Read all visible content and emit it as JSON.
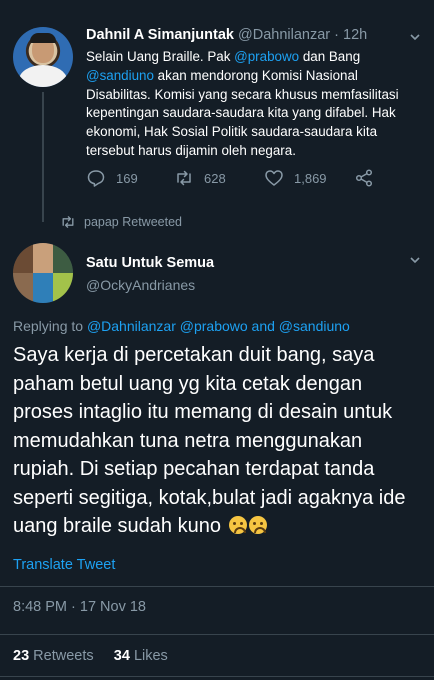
{
  "parent_tweet": {
    "name": "Dahnil A Simanjuntak",
    "handle": "@Dahnilanzar",
    "age": "12h",
    "text_parts": [
      "Selain Uang Braille. Pak ",
      "@prabowo",
      " dan Bang ",
      "@sandiuno",
      " akan mendorong Komisi Nasional Disabilitas. Komisi yang secara khusus memfasilitasi kepentingan saudara-saudara kita yang difabel. Hak ekonomi, Hak Sosial Politik  saudara-saudara kita tersebut harus dijamin oleh negara."
    ],
    "replies": "169",
    "retweets": "628",
    "likes": "1,869"
  },
  "retweet_note": "papap Retweeted",
  "main_tweet": {
    "name": "Satu Untuk Semua",
    "handle": "@OckyAndrianes",
    "replying_label": "Replying to ",
    "replying_to": "@Dahnilanzar @prabowo and @sandiuno",
    "text": "Saya kerja di percetakan duit bang, saya paham betul uang yg kita cetak dengan proses intaglio itu memang di desain untuk memudahkan tuna netra menggunakan rupiah. Di setiap pecahan terdapat tanda seperti segitiga, kotak,bulat jadi agaknya ide uang braile sudah kuno",
    "translate_label": "Translate Tweet",
    "timestamp": "8:48 PM · 17 Nov 18",
    "retweets_count": "23",
    "retweets_label": "Retweets",
    "likes_count": "34",
    "likes_label": "Likes"
  },
  "icons": {
    "reply": "reply-icon",
    "retweet": "retweet-icon",
    "like": "heart-icon",
    "share": "share-icon",
    "caret": "chevron-down-icon",
    "emoji": "crying-face-emoji"
  },
  "colors": {
    "background": "#141d26",
    "text": "#ffffff",
    "muted": "#8899a6",
    "link": "#1da1f2",
    "divider": "#38444d"
  }
}
